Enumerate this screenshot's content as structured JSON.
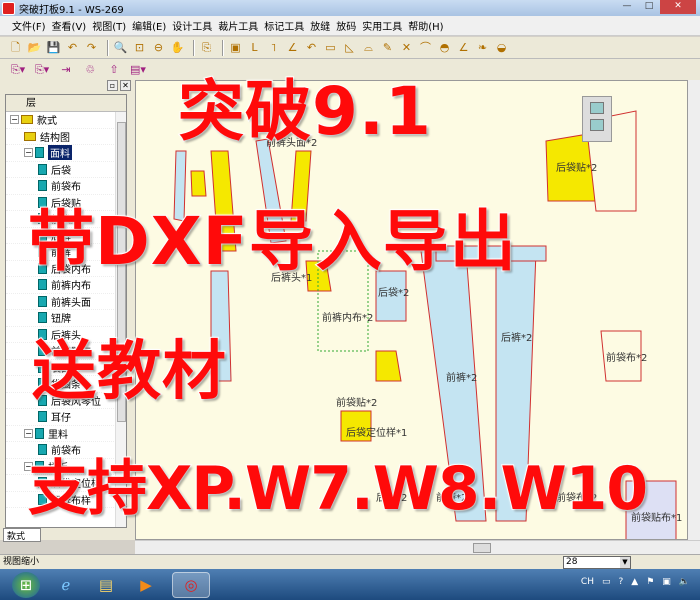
{
  "window": {
    "title": "突破打板9.1 - WS-269",
    "min": "—",
    "max": "□",
    "close": "✕"
  },
  "menu": [
    "文件(F)",
    "查看(V)",
    "视图(T)",
    "编辑(E)",
    "设计工具",
    "裁片工具",
    "标记工具",
    "放缝",
    "放码",
    "实用工具",
    "帮助(H)"
  ],
  "toolbar1": [
    "new-file",
    "open",
    "save",
    "undo",
    "redo",
    "zoom",
    "zoom-fit",
    "zoom-out",
    "pan",
    "pick",
    "rect",
    "corner",
    "angle",
    "line-angle",
    "curve",
    "measure",
    "ruler",
    "triangle",
    "gather",
    "pencil",
    "cross",
    "arc",
    "protractor",
    "angle-tool",
    "drop",
    "shoe"
  ],
  "toolbar1_glyphs": [
    "🗋",
    "📂",
    "💾",
    "↶",
    "↷",
    "🔍",
    "⊡",
    "⊖",
    "✋",
    "⎘",
    "▣",
    "L",
    "˥",
    "∠",
    "↶",
    "▭",
    "◺",
    "⌓",
    "✎",
    "✕",
    "⌒",
    "◓",
    "∠",
    "❧",
    "◒"
  ],
  "toolbar2_glyphs": [
    "⎘▾",
    "⎘▾",
    "⇥",
    "♲",
    "⇧",
    "▤▾"
  ],
  "panel": {
    "header": "层",
    "tab": "款式",
    "pin": "▫",
    "close": "✕",
    "items": [
      {
        "label": "款式",
        "level": 0,
        "toggle": "−",
        "icon": "y"
      },
      {
        "label": "结构图",
        "level": 1,
        "icon": "y"
      },
      {
        "label": "面料",
        "level": 1,
        "toggle": "−",
        "icon": "c",
        "selected": true
      },
      {
        "label": "后袋",
        "level": 2
      },
      {
        "label": "前袋布",
        "level": 2
      },
      {
        "label": "后袋贴",
        "level": 2
      },
      {
        "label": "前袋贴",
        "level": 2
      },
      {
        "label": "后裤",
        "level": 2
      },
      {
        "label": "前裤",
        "level": 2
      },
      {
        "label": "后袋内布",
        "level": 2
      },
      {
        "label": "前裤内布",
        "level": 2
      },
      {
        "label": "前裤头面",
        "level": 2
      },
      {
        "label": "钮牌",
        "level": 2
      },
      {
        "label": "后裤头",
        "level": 2
      },
      {
        "label": "前袋贴布",
        "level": 2
      },
      {
        "label": "袋口条",
        "level": 2
      },
      {
        "label": "袋围条",
        "level": 2
      },
      {
        "label": "后袋风琴位",
        "level": 2
      },
      {
        "label": "耳仔",
        "level": 2
      },
      {
        "label": "里料",
        "level": 1,
        "toggle": "−",
        "icon": "c"
      },
      {
        "label": "前袋布",
        "level": 2
      },
      {
        "label": "样板",
        "level": 1,
        "toggle": "−",
        "icon": "c"
      },
      {
        "label": "后袋定位样",
        "level": 2
      },
      {
        "label": "钮牌布样",
        "level": 2
      }
    ]
  },
  "canvas": {
    "pieces": [
      "前裤头面*2",
      "后裤头*1",
      "前裤内布*2",
      "后袋*2",
      "前裤*2",
      "后裤*2",
      "前袋贴*2",
      "后袋定位样*1",
      "前袋布*2",
      "后袋贴*2",
      "后袋*2",
      "前袋*2",
      "前袋布*2",
      "前袋贴布*1"
    ]
  },
  "status": {
    "text": "视图缩小",
    "zoom": "28"
  },
  "taskbar": {
    "items": [
      "start",
      "ie",
      "explorer",
      "media-player",
      "tupo-app"
    ],
    "tray_lang": "CH"
  },
  "overlay": {
    "line1": "突破9.1",
    "line2": "带DXF导入导出",
    "line3": "送教材",
    "line4": "支持XP.W7.W8.W10"
  },
  "colors": {
    "overlay_text": "#ff0a0a",
    "canvas_bg": "#fdfbe3",
    "piece_yellow": "#f5e800",
    "piece_blue": "#c4e4f2"
  }
}
